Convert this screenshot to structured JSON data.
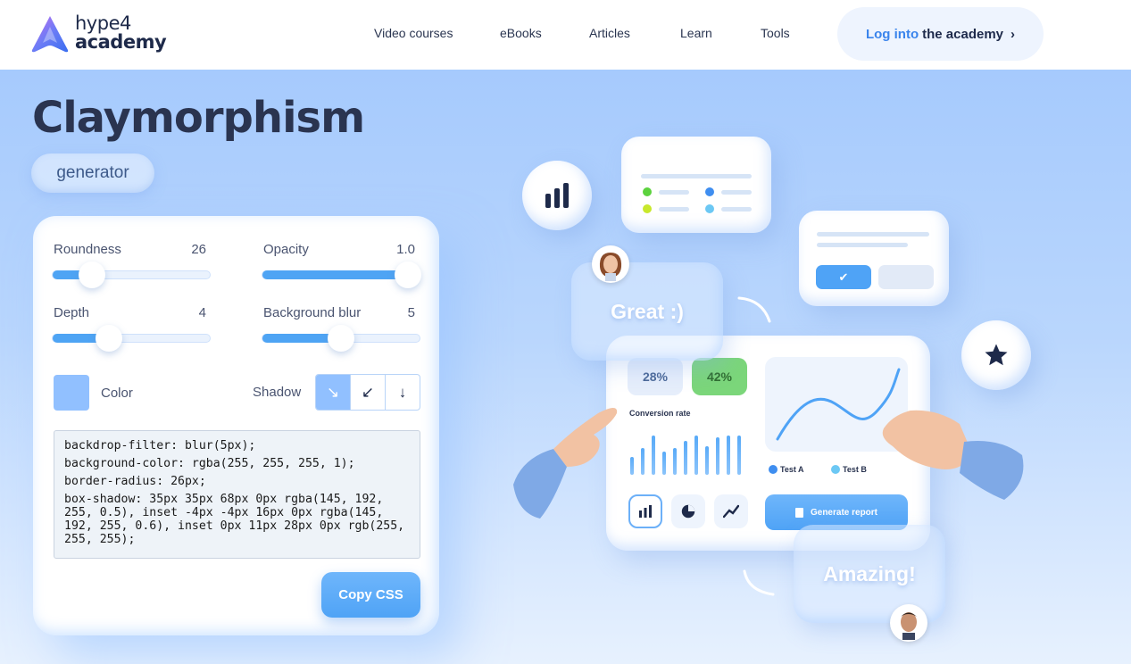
{
  "header": {
    "logo": {
      "line1": "hype4",
      "line2": "academy"
    },
    "nav": [
      "Video courses",
      "eBooks",
      "Articles",
      "Learn",
      "Tools"
    ],
    "login": {
      "part1": "Log into",
      "part2": "the academy",
      "chevron": "›"
    }
  },
  "hero": {
    "title": "Claymorphism",
    "badge": "generator"
  },
  "controls": {
    "roundness": {
      "label": "Roundness",
      "value": "26",
      "fraction": 0.25
    },
    "opacity": {
      "label": "Opacity",
      "value": "1.0",
      "fraction": 1.0
    },
    "depth": {
      "label": "Depth",
      "value": "4",
      "fraction": 0.36
    },
    "blur": {
      "label": "Background blur",
      "value": "5",
      "fraction": 0.5
    },
    "color": {
      "label": "Color",
      "value": "#91c0ff"
    },
    "shadow": {
      "label": "Shadow",
      "options": [
        "↘",
        "↙",
        "↓"
      ],
      "selected": 0
    }
  },
  "code": {
    "lines": [
      "backdrop-filter: blur(5px);",
      "background-color: rgba(255, 255, 255, 1);",
      "border-radius: 26px;",
      "box-shadow: 35px 35px 68px 0px rgba(145, 192, 255, 0.5), inset -4px -4px 16px 0px rgba(145, 192, 255, 0.6), inset 0px 11px 28px 0px rgb(255, 255, 255);"
    ]
  },
  "copy_label": "Copy CSS",
  "illustration": {
    "bubble1": "Great :)",
    "bubble2": "Amazing!",
    "pct_a": "28%",
    "pct_b": "42%",
    "conversion": "Conversion rate",
    "legend_a": "Test A",
    "legend_b": "Test B",
    "report_button": "Generate report"
  },
  "colors": {
    "accent": "#4ea4f4",
    "brand_dark": "#1e2a4a",
    "login_link": "#3a84ec",
    "green": "#7bd67a"
  }
}
